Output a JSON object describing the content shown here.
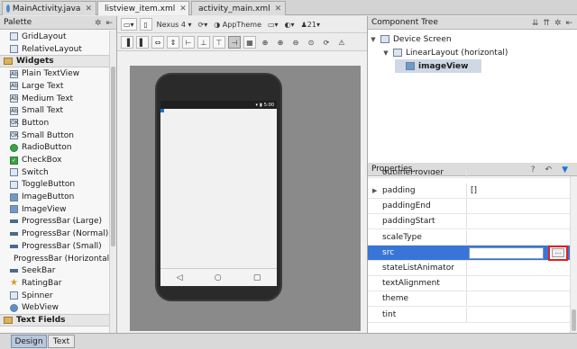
{
  "tabs": [
    {
      "label": "MainActivity.java",
      "icon": "java-file-icon",
      "active": false
    },
    {
      "label": "listview_item.xml",
      "icon": "xml-file-icon",
      "active": true
    },
    {
      "label": "activity_main.xml",
      "icon": "xml-file-icon",
      "active": false
    }
  ],
  "palette": {
    "title": "Palette",
    "items_top": [
      "GridLayout",
      "RelativeLayout"
    ],
    "widgets_category": "Widgets",
    "widgets": [
      {
        "label": "Plain TextView",
        "icon": "textview-icon",
        "glyph": "Ab"
      },
      {
        "label": "Large Text",
        "icon": "textview-icon",
        "glyph": "Ab"
      },
      {
        "label": "Medium Text",
        "icon": "textview-icon",
        "glyph": "Ab"
      },
      {
        "label": "Small Text",
        "icon": "textview-icon",
        "glyph": "Ab"
      },
      {
        "label": "Button",
        "icon": "button-icon",
        "glyph": "OK"
      },
      {
        "label": "Small Button",
        "icon": "button-icon",
        "glyph": "OK"
      },
      {
        "label": "RadioButton",
        "icon": "radio-icon",
        "glyph": ""
      },
      {
        "label": "CheckBox",
        "icon": "checkbox-icon",
        "glyph": "✓"
      },
      {
        "label": "Switch",
        "icon": "switch-icon",
        "glyph": ""
      },
      {
        "label": "ToggleButton",
        "icon": "toggle-icon",
        "glyph": ""
      },
      {
        "label": "ImageButton",
        "icon": "image-icon",
        "glyph": ""
      },
      {
        "label": "ImageView",
        "icon": "image-icon",
        "glyph": ""
      },
      {
        "label": "ProgressBar (Large)",
        "icon": "progressbar-icon",
        "glyph": ""
      },
      {
        "label": "ProgressBar (Normal)",
        "icon": "progressbar-icon",
        "glyph": ""
      },
      {
        "label": "ProgressBar (Small)",
        "icon": "progressbar-icon",
        "glyph": ""
      },
      {
        "label": "ProgressBar (Horizontal)",
        "icon": "progressbar-icon",
        "glyph": ""
      },
      {
        "label": "SeekBar",
        "icon": "seekbar-icon",
        "glyph": ""
      },
      {
        "label": "RatingBar",
        "icon": "star-icon",
        "glyph": "★"
      },
      {
        "label": "Spinner",
        "icon": "spinner-icon",
        "glyph": ""
      },
      {
        "label": "WebView",
        "icon": "globe-icon",
        "glyph": ""
      }
    ],
    "textfields_category": "Text Fields"
  },
  "design_toolbar": {
    "device": "Nexus 4",
    "theme": "AppTheme",
    "api": "21"
  },
  "device_preview": {
    "time": "5:00"
  },
  "component_tree": {
    "title": "Component Tree",
    "root": "Device Screen",
    "layout": "LinearLayout (horizontal)",
    "selected": "imageView"
  },
  "properties": {
    "title": "Properties",
    "rows": [
      {
        "name": "outlineProvider",
        "value": "",
        "cut": true
      },
      {
        "name": "padding",
        "value": "[]",
        "expandable": true
      },
      {
        "name": "paddingEnd",
        "value": ""
      },
      {
        "name": "paddingStart",
        "value": ""
      },
      {
        "name": "scaleType",
        "value": ""
      },
      {
        "name": "src",
        "value": "",
        "selected": true
      },
      {
        "name": "stateListAnimator",
        "value": ""
      },
      {
        "name": "textAlignment",
        "value": ""
      },
      {
        "name": "theme",
        "value": ""
      },
      {
        "name": "tint",
        "value": ""
      }
    ],
    "browse_button": "..."
  },
  "bottom_tabs": {
    "design": "Design",
    "text": "Text"
  },
  "colors": {
    "selection": "#3875d7",
    "highlight_box": "#e02020"
  }
}
